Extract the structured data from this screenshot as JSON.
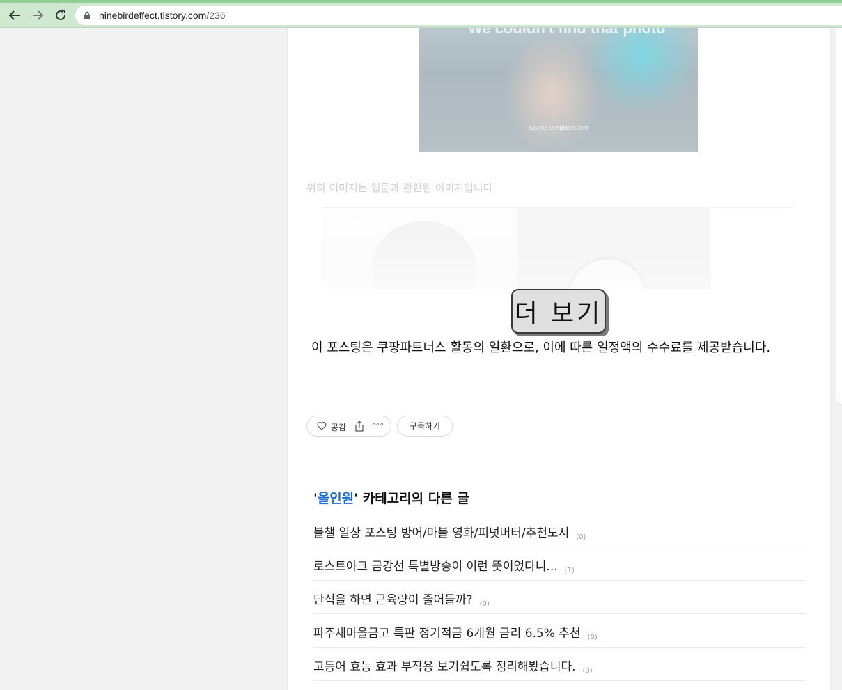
{
  "browser": {
    "url_host": "ninebirdeffect.tistory.com",
    "url_path": "/236"
  },
  "post": {
    "hero": {
      "cut_text": "We couldn't find that photo",
      "source_text": "source.unsplash.com"
    },
    "image_caption": "위의 이미지는 웹툰과 관련된 이미지입니다.",
    "more_button": "더 보기",
    "affiliate_notice": "이 포스팅은 쿠팡파트너스 활동의 일환으로, 이에 따른 일정액의 수수료를 제공받습니다.",
    "actions": {
      "like_label": "공감",
      "more_glyph": "∘∘∘",
      "subscribe_label": "구독하기"
    }
  },
  "related": {
    "quote_open": "'",
    "category": "올인원",
    "quote_close": "'",
    "title_suffix": " 카테고리의 다른 글",
    "items": [
      {
        "title": "블챌 일상 포스팅 방어/마블 영화/피넛버터/추천도서",
        "count": "(0)"
      },
      {
        "title": "로스트아크 금강선 특별방송이 이런 뜻이었다니...",
        "count": "(1)"
      },
      {
        "title": "단식을 하면 근육량이 줄어들까?",
        "count": "(0)"
      },
      {
        "title": "파주새마을금고 특판 정기적금 6개월 금리 6.5% 추천",
        "count": "(0)"
      },
      {
        "title": "고등어 효능 효과 부작용 보기쉽도록 정리해봤습니다.",
        "count": "(0)"
      }
    ]
  },
  "colors": {
    "browser_bar": "#cfe9d0",
    "category_link": "#1d6ad0"
  }
}
